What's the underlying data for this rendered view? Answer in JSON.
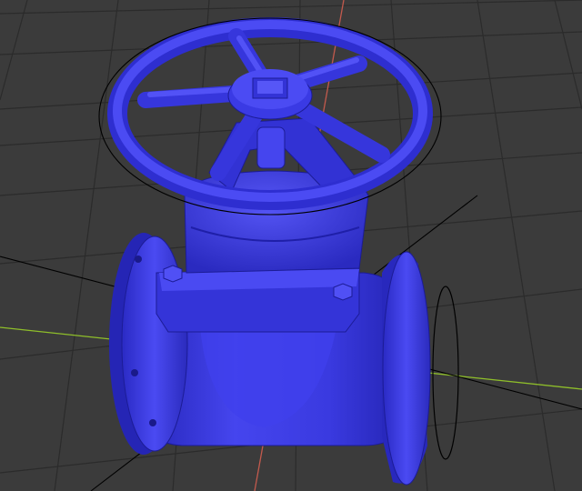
{
  "viewport": {
    "background": "#3b3b3b",
    "grid_color": "#2b2b2b",
    "x_axis_color": "#8fbf2a",
    "y_axis_color": "#c25a4d",
    "gizmo_color": "#000000"
  },
  "model": {
    "name": "gate-valve",
    "material_color": "#3a3ae6",
    "shadow_color": "#1f1fa8",
    "highlight_color": "#6a6aff"
  },
  "icons": [
    "rotate-gizmo-ring"
  ]
}
